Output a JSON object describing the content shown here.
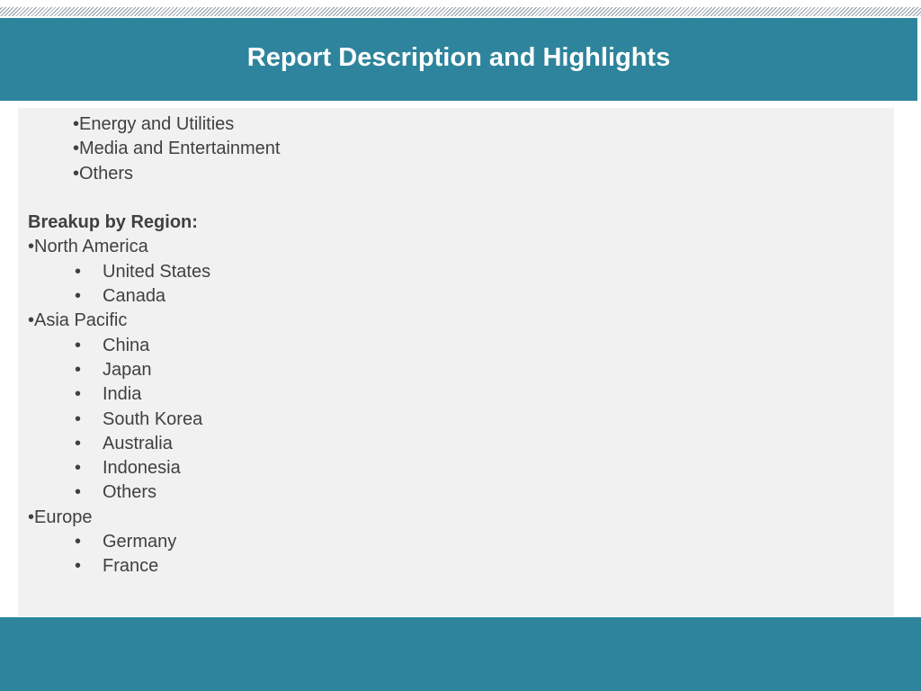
{
  "header": {
    "title": "Report Description and Highlights"
  },
  "content": {
    "industry_items": [
      "•Energy and Utilities",
      "•Media and Entertainment",
      "•Others"
    ],
    "region_heading": "Breakup by Region:",
    "regions": {
      "north_america": {
        "label": "•North America",
        "countries": [
          "United States",
          "Canada"
        ]
      },
      "asia_pacific": {
        "label": "•Asia Pacific",
        "countries": [
          "China",
          "Japan",
          "India",
          "South Korea",
          "Australia",
          "Indonesia",
          "Others"
        ]
      },
      "europe": {
        "label": "•Europe",
        "countries": [
          "Germany",
          "France"
        ]
      }
    },
    "bullet_glyph": "•"
  },
  "colors": {
    "brand_teal": "#2e849c",
    "panel_gray": "#f1f1f1",
    "text": "#404040"
  }
}
